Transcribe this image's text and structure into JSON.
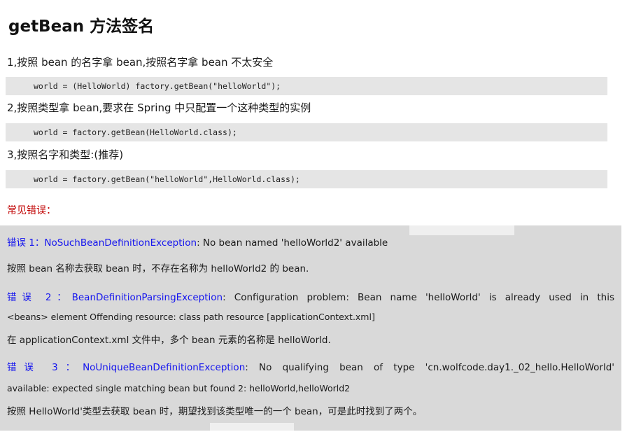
{
  "title": "getBean 方法签名",
  "steps": [
    {
      "text": "1,按照 bean 的名字拿 bean,按照名字拿 bean 不太安全",
      "code": "world = (HelloWorld) factory.getBean(\"helloWorld\");"
    },
    {
      "text": "2,按照类型拿 bean,要求在 Spring 中只配置一个这种类型的实例",
      "code": "world = factory.getBean(HelloWorld.class);"
    },
    {
      "text": "3,按照名字和类型:(推荐)",
      "code": "world = factory.getBean(\"helloWorld\",HelloWorld.class);"
    }
  ],
  "errors_heading": "常见错误：",
  "errors": [
    {
      "label": "错误 1：",
      "exception": "NoSuchBeanDefinitionException",
      "message": ": No bean named 'helloWorld2' available",
      "message2": "",
      "explanation": "按照 bean 名称去获取 bean 时，不存在名称为 helloWorld2 的 bean."
    },
    {
      "label": "错误 2：",
      "exception": "BeanDefinitionParsingException",
      "message": ": Configuration problem: Bean name 'helloWorld' is already used in this",
      "message2": "<beans> element Offending resource: class path resource [applicationContext.xml]",
      "explanation": "在 applicationContext.xml 文件中，多个 bean 元素的名称是 helloWorld."
    },
    {
      "label": "错误 3：",
      "exception": "NoUniqueBeanDefinitionException",
      "message": ": No qualifying bean of type 'cn.wolfcode.day1._02_hello.HelloWorld'",
      "message2": "available: expected single matching bean but found 2: helloWorld,helloWorld2",
      "explanation": "按照 HelloWorld'类型去获取 bean 时，期望找到该类型唯一的一个 bean，可是此时找到了两个。"
    }
  ],
  "colors": {
    "error_heading": "#c00000",
    "link_blue": "#1515ee",
    "code_bg": "#e5e5e5",
    "error_bg": "#d9d9d9"
  }
}
